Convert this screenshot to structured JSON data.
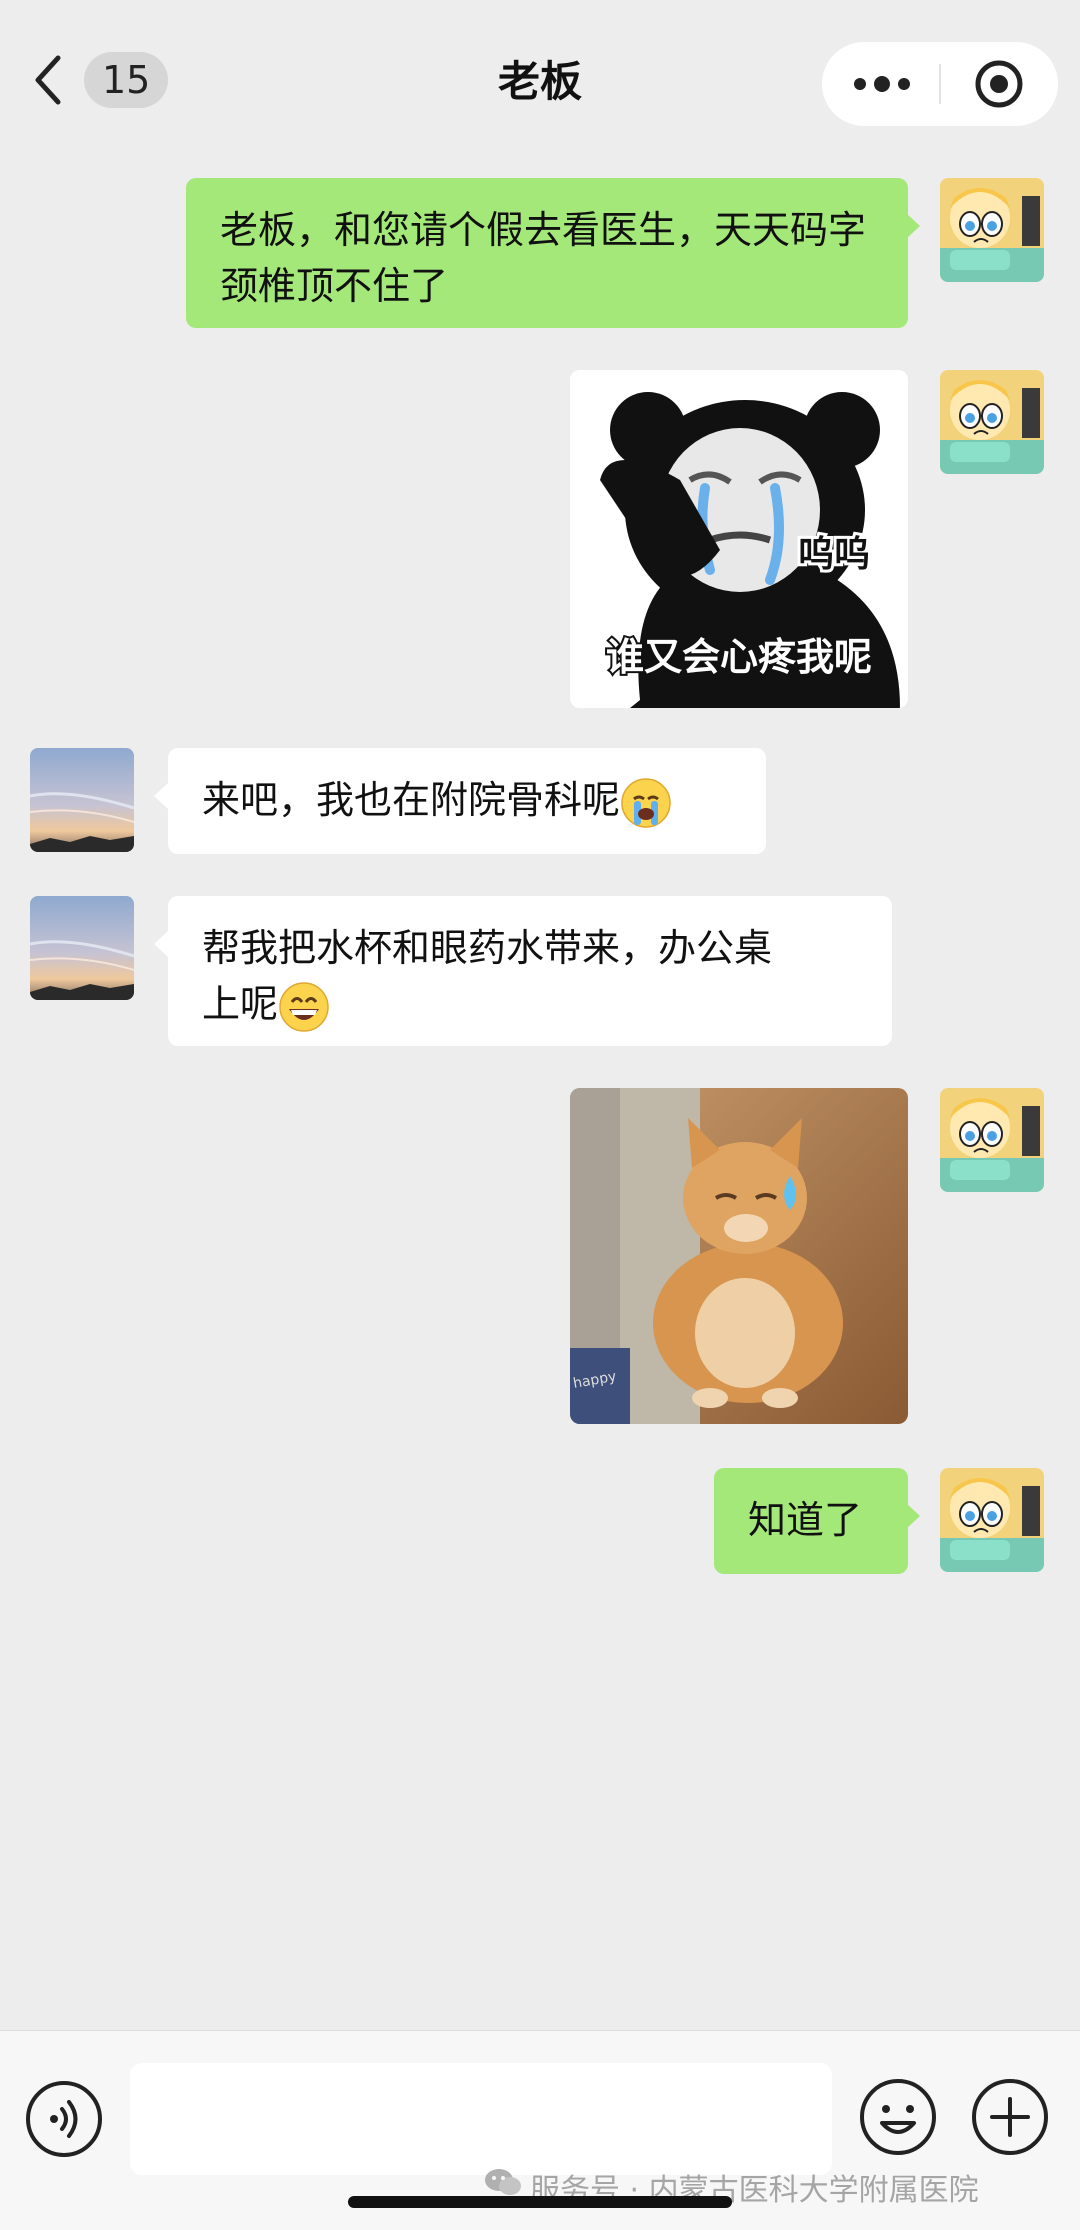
{
  "header": {
    "unread_count": "15",
    "title": "老板"
  },
  "messages": [
    {
      "from": "me",
      "type": "text",
      "text": "老板，和您请个假去看医生，天天码字颈椎顶不住了"
    },
    {
      "from": "me",
      "type": "sticker",
      "caption_line1": "呜呜",
      "caption_line2": "谁又会心疼我呢"
    },
    {
      "from": "other",
      "type": "text",
      "text": "来吧，我也在附院骨科呢",
      "emoji": "crying-face"
    },
    {
      "from": "other",
      "type": "text",
      "text_line1": "帮我把水杯和眼药水带来，办公桌",
      "text_line2": "上呢",
      "emoji": "grinning-face"
    },
    {
      "from": "me",
      "type": "image",
      "image_text": "happy",
      "subject": "orange-cat-sweat-drop"
    },
    {
      "from": "me",
      "type": "text",
      "text": "知道了"
    }
  ],
  "watermark": "服务号 · 内蒙古医科大学附属医院",
  "colors": {
    "background": "#ededed",
    "my_bubble": "#a5e87a",
    "other_bubble": "#ffffff",
    "bottom_bar": "#f7f7f7"
  }
}
